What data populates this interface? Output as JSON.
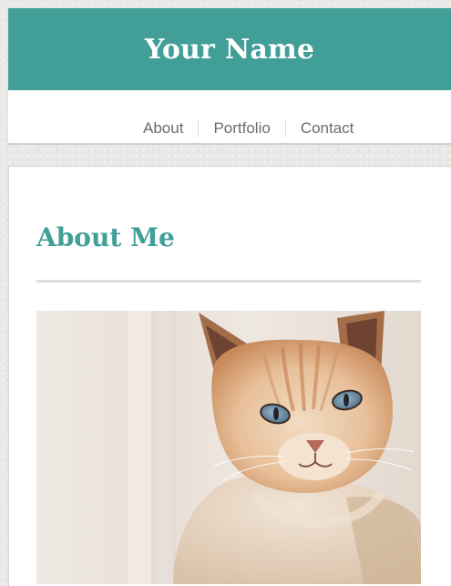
{
  "header": {
    "site_title": "Your Name"
  },
  "nav": {
    "items": [
      {
        "label": "About"
      },
      {
        "label": "Portfolio"
      },
      {
        "label": "Contact"
      }
    ]
  },
  "main": {
    "section_title": "About Me",
    "photo": {
      "subject": "cat-photo"
    }
  },
  "colors": {
    "accent": "#419f98",
    "nav_text": "#6c6c6c",
    "divider": "#dddddd"
  }
}
